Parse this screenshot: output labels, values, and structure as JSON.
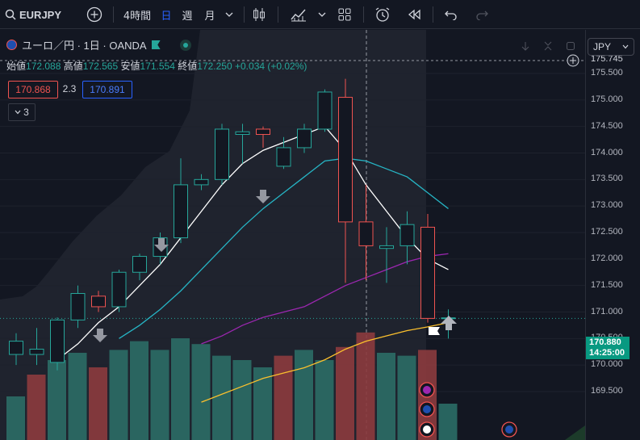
{
  "toolbar": {
    "symbol": "EURJPY",
    "interval_4h": "4時間",
    "interval_day": "日",
    "interval_week": "週",
    "interval_month": "月"
  },
  "legend": {
    "title": "ユーロ／円 · 1日 · OANDA",
    "open_label": "始値",
    "open_value": "172.088",
    "high_label": "高値",
    "high_value": "172.565",
    "low_label": "安値",
    "low_value": "171.554",
    "close_label": "終値",
    "close_value": "172.250",
    "change": "+0.034 (+0.02%)",
    "sell_price": "170.868",
    "spread": "2.3",
    "buy_price": "170.891",
    "indicators_count": "3"
  },
  "axis": {
    "currency": "JPY",
    "top_value": "175.745",
    "ticks": [
      "175.500",
      "175.000",
      "174.500",
      "174.000",
      "173.500",
      "173.000",
      "172.500",
      "172.000",
      "171.500",
      "171.000",
      "170.500",
      "170.000",
      "169.500"
    ],
    "last_price": "170.880",
    "countdown": "14:25:00"
  },
  "colors": {
    "up": "#26a69a",
    "down": "#ef5350",
    "bg": "#131722",
    "ma_white": "#ffffff",
    "ma_teal": "#26b5c5",
    "ma_purple": "#9c27b0",
    "ma_yellow": "#fbc02d"
  },
  "chart_data": {
    "type": "candlestick",
    "ylim": [
      169.3,
      175.9
    ],
    "candles": [
      {
        "o": 170.2,
        "h": 170.6,
        "l": 170.0,
        "c": 170.45
      },
      {
        "o": 170.2,
        "h": 170.7,
        "l": 170.0,
        "c": 170.3
      },
      {
        "o": 170.05,
        "h": 170.9,
        "l": 169.9,
        "c": 170.85
      },
      {
        "o": 170.85,
        "h": 171.5,
        "l": 170.7,
        "c": 171.35
      },
      {
        "o": 171.3,
        "h": 171.4,
        "l": 171.0,
        "c": 171.1
      },
      {
        "o": 171.1,
        "h": 171.8,
        "l": 171.0,
        "c": 171.75
      },
      {
        "o": 171.75,
        "h": 172.1,
        "l": 171.6,
        "c": 172.05
      },
      {
        "o": 172.05,
        "h": 172.5,
        "l": 171.9,
        "c": 172.4
      },
      {
        "o": 172.4,
        "h": 173.9,
        "l": 172.3,
        "c": 173.4
      },
      {
        "o": 173.4,
        "h": 173.6,
        "l": 173.3,
        "c": 173.5
      },
      {
        "o": 173.5,
        "h": 174.55,
        "l": 173.4,
        "c": 174.45
      },
      {
        "o": 174.35,
        "h": 174.55,
        "l": 173.8,
        "c": 174.4
      },
      {
        "o": 174.45,
        "h": 174.5,
        "l": 174.1,
        "c": 174.35
      },
      {
        "o": 173.75,
        "h": 174.3,
        "l": 173.7,
        "c": 174.1
      },
      {
        "o": 174.1,
        "h": 174.55,
        "l": 174.0,
        "c": 174.45
      },
      {
        "o": 174.45,
        "h": 175.2,
        "l": 174.4,
        "c": 175.15
      },
      {
        "o": 175.05,
        "h": 175.4,
        "l": 171.55,
        "c": 172.7
      },
      {
        "o": 172.7,
        "h": 173.4,
        "l": 171.6,
        "c": 172.25
      },
      {
        "o": 172.2,
        "h": 172.6,
        "l": 171.55,
        "c": 172.25
      },
      {
        "o": 172.25,
        "h": 172.9,
        "l": 171.9,
        "c": 172.65
      },
      {
        "o": 172.6,
        "h": 172.85,
        "l": 170.8,
        "c": 170.88
      },
      {
        "o": 170.88,
        "h": 171.05,
        "l": 170.5,
        "c": 170.89
      }
    ],
    "volumes": [
      0.3,
      0.45,
      0.55,
      0.6,
      0.5,
      0.62,
      0.68,
      0.62,
      0.7,
      0.66,
      0.58,
      0.55,
      0.5,
      0.58,
      0.62,
      0.55,
      0.64,
      0.74,
      0.6,
      0.58,
      0.62,
      0.25
    ],
    "volume_colors": [
      "up",
      "down",
      "up",
      "up",
      "down",
      "up",
      "up",
      "up",
      "up",
      "up",
      "up",
      "up",
      "up",
      "down",
      "up",
      "up",
      "down",
      "down",
      "up",
      "up",
      "down",
      "up"
    ],
    "ma_white": [
      null,
      null,
      170.1,
      170.4,
      170.8,
      171.1,
      171.5,
      171.9,
      172.4,
      172.9,
      173.4,
      173.8,
      174.05,
      174.2,
      174.35,
      174.5,
      174.05,
      173.4,
      172.9,
      172.4,
      172.0,
      171.8
    ],
    "ma_teal": [
      null,
      null,
      null,
      null,
      null,
      170.5,
      170.75,
      171.05,
      171.4,
      171.8,
      172.2,
      172.6,
      172.95,
      173.25,
      173.55,
      173.85,
      173.9,
      173.85,
      173.7,
      173.55,
      173.25,
      172.95
    ],
    "ma_purple": [
      null,
      null,
      null,
      null,
      null,
      null,
      null,
      null,
      null,
      170.4,
      170.55,
      170.75,
      170.9,
      171.0,
      171.1,
      171.3,
      171.5,
      171.65,
      171.8,
      171.95,
      172.05,
      172.1
    ],
    "ma_yellow": [
      null,
      null,
      null,
      null,
      null,
      null,
      null,
      null,
      null,
      169.3,
      169.45,
      169.6,
      169.75,
      169.85,
      169.95,
      170.1,
      170.3,
      170.45,
      170.55,
      170.65,
      170.72,
      170.8
    ]
  }
}
